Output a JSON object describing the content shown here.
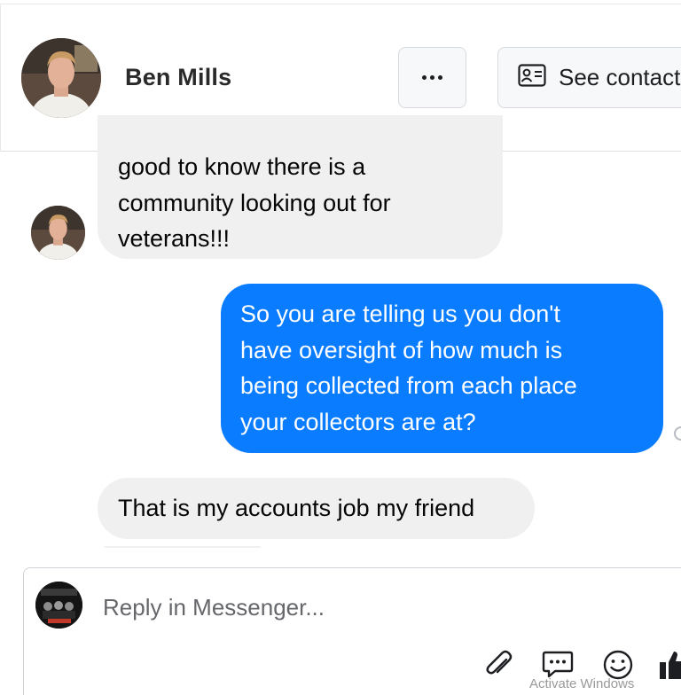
{
  "header": {
    "contact_name": "Ben Mills",
    "more_button_icon": "more-horizontal-icon",
    "see_contact_label": "See contact",
    "contact_card_icon": "contact-card-icon"
  },
  "messages": [
    {
      "direction": "incoming",
      "lines": [
        "good to know there is a",
        "community looking out for",
        "veterans!!!"
      ]
    },
    {
      "direction": "outgoing",
      "lines": [
        "So you are telling us you don't",
        "have oversight of how much is",
        "being collected from each place",
        "your collectors are at?"
      ]
    },
    {
      "direction": "incoming",
      "lines": [
        "That is my accounts job my friend"
      ]
    }
  ],
  "composer": {
    "placeholder": "Reply in Messenger...",
    "tools": [
      "paperclip-icon",
      "message-bubble-icon",
      "emoji-icon",
      "thumbs-up-icon"
    ]
  },
  "colors": {
    "outgoing_bubble": "#0a7cff",
    "incoming_bubble": "#f0f0f0",
    "text_dark": "#050505",
    "placeholder_text": "#65676b"
  },
  "watermark": "Activate Windows"
}
